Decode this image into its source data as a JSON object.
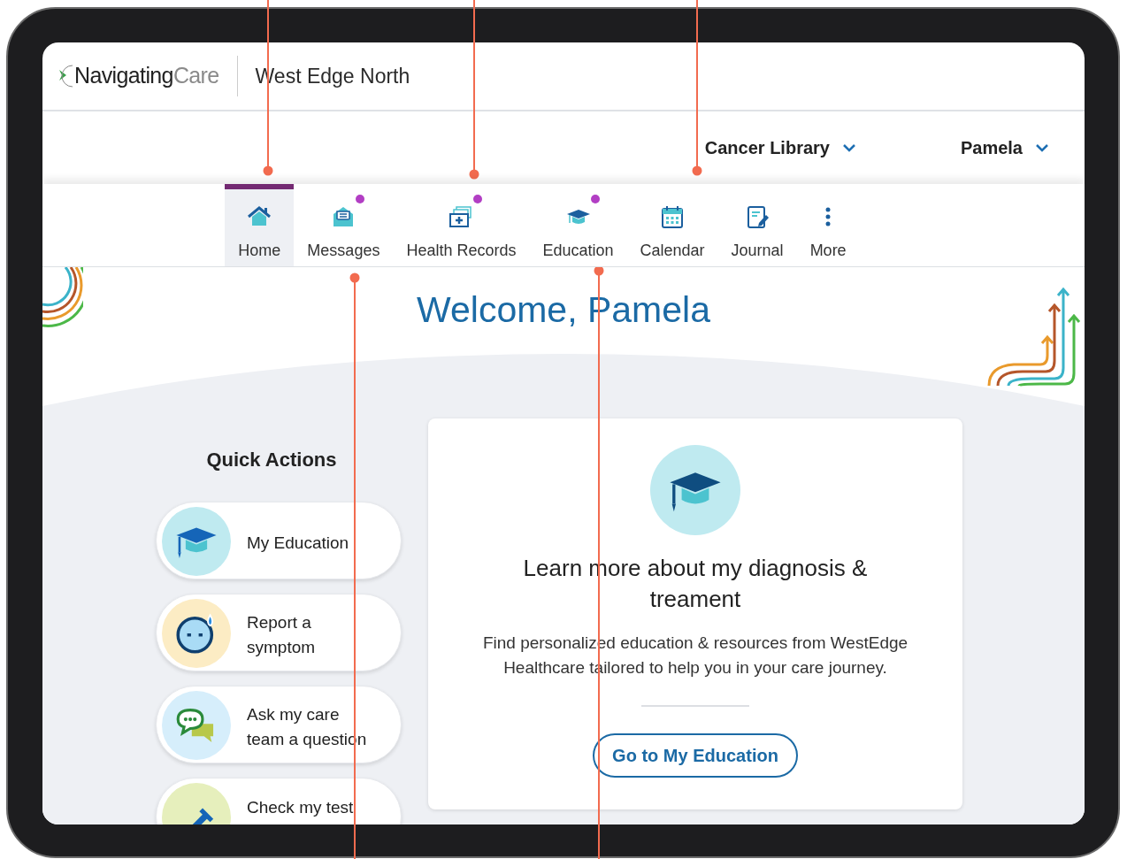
{
  "header": {
    "logo_main": "Navigating",
    "logo_accent": "Care",
    "organization": "West Edge North"
  },
  "top_menu": [
    {
      "label": "Cancer Library"
    },
    {
      "label": "Pamela"
    }
  ],
  "nav": [
    {
      "label": "Home",
      "selected": true,
      "notification": false
    },
    {
      "label": "Messages",
      "selected": false,
      "notification": true
    },
    {
      "label": "Health Records",
      "selected": false,
      "notification": true
    },
    {
      "label": "Education",
      "selected": false,
      "notification": true
    },
    {
      "label": "Calendar",
      "selected": false,
      "notification": false
    },
    {
      "label": "Journal",
      "selected": false,
      "notification": false
    },
    {
      "label": "More",
      "selected": false,
      "notification": false
    }
  ],
  "welcome": "Welcome, Pamela",
  "quick_actions": {
    "title": "Quick Actions",
    "items": [
      {
        "label": "My Education"
      },
      {
        "label": "Report a symptom"
      },
      {
        "label": "Ask my care team a question"
      },
      {
        "label": "Check my test"
      }
    ]
  },
  "card": {
    "title": "Learn more about my diagnosis & treament",
    "text": "Find personalized education & resources from WestEdge Healthcare tailored to help you in your care journey.",
    "button": "Go to My Education"
  }
}
